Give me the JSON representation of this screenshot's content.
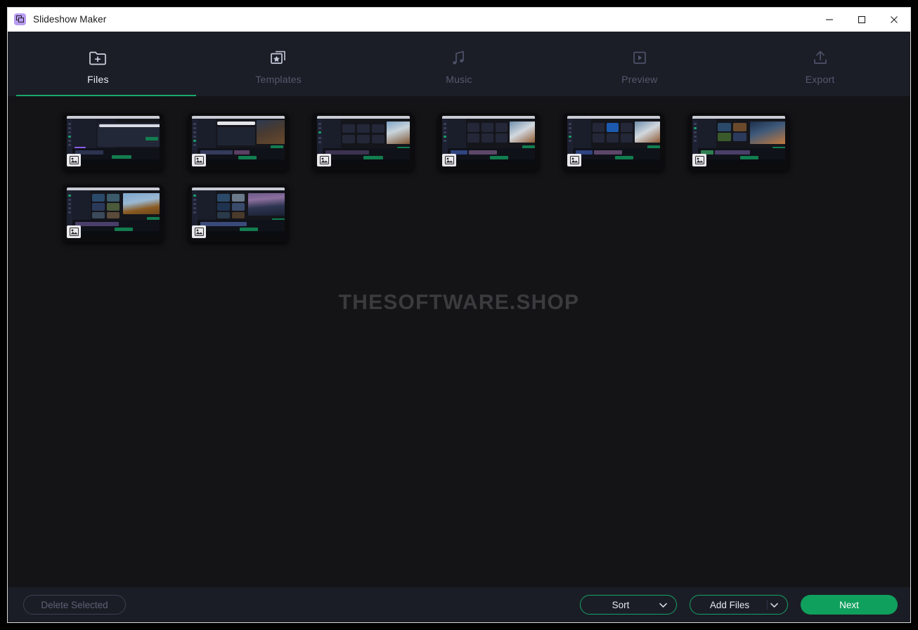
{
  "window": {
    "title": "Slideshow Maker",
    "app_icon": "slides-icon",
    "controls": {
      "minimize": "minimize-icon",
      "maximize": "maximize-icon",
      "close": "close-icon"
    }
  },
  "tabs": [
    {
      "label": "Files",
      "icon": "folder-plus-icon",
      "active": true
    },
    {
      "label": "Templates",
      "icon": "star-slides-icon",
      "active": false
    },
    {
      "label": "Music",
      "icon": "music-note-icon",
      "active": false
    },
    {
      "label": "Preview",
      "icon": "play-square-icon",
      "active": false
    },
    {
      "label": "Export",
      "icon": "upload-icon",
      "active": false
    }
  ],
  "colors": {
    "accent_green": "#13a265",
    "next_button": "#10a05d",
    "header_bg": "#1b1d27",
    "content_bg": "#141417",
    "footer_bg": "#1b1d26",
    "titlebar_bg": "#ffffff",
    "app_icon_purple": "#b99cf0"
  },
  "main": {
    "watermark": "THESOFTWARE.SHOP",
    "thumbnails": [
      {
        "name": "thumbnail-1",
        "badge": "image-placeholder-icon",
        "variant": "export-dialog"
      },
      {
        "name": "thumbnail-2",
        "badge": "image-placeholder-icon",
        "variant": "effects-list"
      },
      {
        "name": "thumbnail-3",
        "badge": "image-placeholder-icon",
        "variant": "settings-tiles"
      },
      {
        "name": "thumbnail-4",
        "badge": "image-placeholder-icon",
        "variant": "elements-grid"
      },
      {
        "name": "thumbnail-5",
        "badge": "image-placeholder-icon",
        "variant": "transitions-grid"
      },
      {
        "name": "thumbnail-6",
        "badge": "image-placeholder-icon",
        "variant": "media-grid"
      },
      {
        "name": "thumbnail-7",
        "badge": "image-placeholder-icon",
        "variant": "media-library"
      },
      {
        "name": "thumbnail-8",
        "badge": "image-placeholder-icon",
        "variant": "city-library"
      }
    ]
  },
  "footer": {
    "delete_selected": "Delete Selected",
    "delete_enabled": false,
    "sort": "Sort",
    "add_files": "Add Files",
    "next": "Next"
  }
}
